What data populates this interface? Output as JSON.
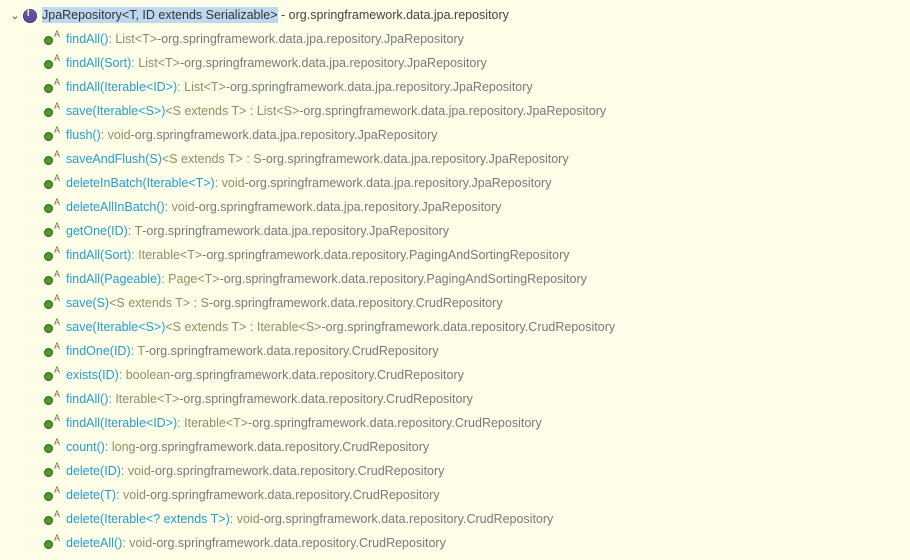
{
  "header": {
    "class_name": "JpaRepository<T, ID extends Serializable>",
    "package_sep": " - ",
    "package": "org.springframework.data.jpa.repository"
  },
  "methods": [
    {
      "name": "findAll()",
      "ret": " : List<T>",
      "sep": " - ",
      "loc": "org.springframework.data.jpa.repository.JpaRepository"
    },
    {
      "name": "findAll(Sort)",
      "ret": " : List<T>",
      "sep": " - ",
      "loc": "org.springframework.data.jpa.repository.JpaRepository"
    },
    {
      "name": "findAll(Iterable<ID>)",
      "ret": " : List<T>",
      "sep": " - ",
      "loc": "org.springframework.data.jpa.repository.JpaRepository"
    },
    {
      "name": "save(Iterable<S>)",
      "ret": " <S extends T> : List<S>",
      "sep": " - ",
      "loc": "org.springframework.data.jpa.repository.JpaRepository"
    },
    {
      "name": "flush()",
      "ret": " : void",
      "sep": " - ",
      "loc": "org.springframework.data.jpa.repository.JpaRepository"
    },
    {
      "name": "saveAndFlush(S)",
      "ret": " <S extends T> : S",
      "sep": " - ",
      "loc": "org.springframework.data.jpa.repository.JpaRepository"
    },
    {
      "name": "deleteInBatch(Iterable<T>)",
      "ret": " : void",
      "sep": " - ",
      "loc": "org.springframework.data.jpa.repository.JpaRepository"
    },
    {
      "name": "deleteAllInBatch()",
      "ret": " : void",
      "sep": " - ",
      "loc": "org.springframework.data.jpa.repository.JpaRepository"
    },
    {
      "name": "getOne(ID)",
      "ret": " : T",
      "sep": " - ",
      "loc": "org.springframework.data.jpa.repository.JpaRepository"
    },
    {
      "name": "findAll(Sort)",
      "ret": " : Iterable<T>",
      "sep": " - ",
      "loc": "org.springframework.data.repository.PagingAndSortingRepository"
    },
    {
      "name": "findAll(Pageable)",
      "ret": " : Page<T>",
      "sep": " - ",
      "loc": "org.springframework.data.repository.PagingAndSortingRepository"
    },
    {
      "name": "save(S)",
      "ret": " <S extends T> : S",
      "sep": " - ",
      "loc": "org.springframework.data.repository.CrudRepository"
    },
    {
      "name": "save(Iterable<S>)",
      "ret": " <S extends T> : Iterable<S>",
      "sep": " - ",
      "loc": "org.springframework.data.repository.CrudRepository"
    },
    {
      "name": "findOne(ID)",
      "ret": " : T",
      "sep": " - ",
      "loc": "org.springframework.data.repository.CrudRepository"
    },
    {
      "name": "exists(ID)",
      "ret": " : boolean",
      "sep": " - ",
      "loc": "org.springframework.data.repository.CrudRepository"
    },
    {
      "name": "findAll()",
      "ret": " : Iterable<T>",
      "sep": " - ",
      "loc": "org.springframework.data.repository.CrudRepository"
    },
    {
      "name": "findAll(Iterable<ID>)",
      "ret": " : Iterable<T>",
      "sep": " - ",
      "loc": "org.springframework.data.repository.CrudRepository"
    },
    {
      "name": "count()",
      "ret": " : long",
      "sep": " - ",
      "loc": "org.springframework.data.repository.CrudRepository"
    },
    {
      "name": "delete(ID)",
      "ret": " : void",
      "sep": " - ",
      "loc": "org.springframework.data.repository.CrudRepository"
    },
    {
      "name": "delete(T)",
      "ret": " : void",
      "sep": " - ",
      "loc": "org.springframework.data.repository.CrudRepository"
    },
    {
      "name": "delete(Iterable<? extends T>)",
      "ret": " : void",
      "sep": " - ",
      "loc": "org.springframework.data.repository.CrudRepository"
    },
    {
      "name": "deleteAll()",
      "ret": " : void",
      "sep": " - ",
      "loc": "org.springframework.data.repository.CrudRepository"
    }
  ]
}
